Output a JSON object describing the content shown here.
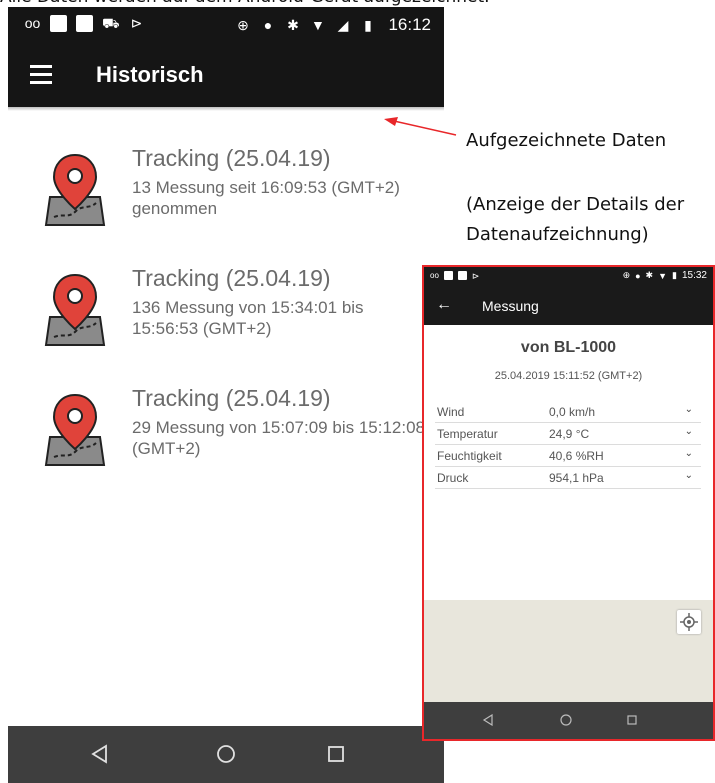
{
  "caption": "Alle Daten werden auf dem Android-Gerät aufgezeichnet.",
  "status_bar": {
    "time": "16:12"
  },
  "app_bar": {
    "title": "Historisch"
  },
  "tracks": [
    {
      "title": "Tracking (25.04.19)",
      "description": "13 Messung seit 16:09:53 (GMT+2) genommen"
    },
    {
      "title": "Tracking (25.04.19)",
      "description": "136 Messung von 15:34:01 bis 15:56:53 (GMT+2)"
    },
    {
      "title": "Tracking (25.04.19)",
      "description": "29 Messung von 15:07:09 bis 15:12:08 (GMT+2)"
    }
  ],
  "annotations": {
    "recorded": "Aufgezeichnete Daten",
    "details": "(Anzeige der Details der Datenaufzeichnung)",
    "arrow_color": "#e8272a"
  },
  "detail_screen": {
    "status_time": "15:32",
    "back_icon": "arrow-left-icon",
    "title": "Messung",
    "device": "von BL-1000",
    "timestamp": "25.04.2019 15:11:52 (GMT+2)",
    "rows": [
      {
        "label": "Wind",
        "value": "0,0 km/h"
      },
      {
        "label": "Temperatur",
        "value": "24,9 °C"
      },
      {
        "label": "Feuchtigkeit",
        "value": "40,6 %RH"
      },
      {
        "label": "Druck",
        "value": "954,1 hPa"
      }
    ],
    "border_color": "#e8272a"
  },
  "colors": {
    "bar": "#151515",
    "nav": "#3e3e3e",
    "pin": "#e0433a",
    "map_gray": "#8a8a8a"
  }
}
